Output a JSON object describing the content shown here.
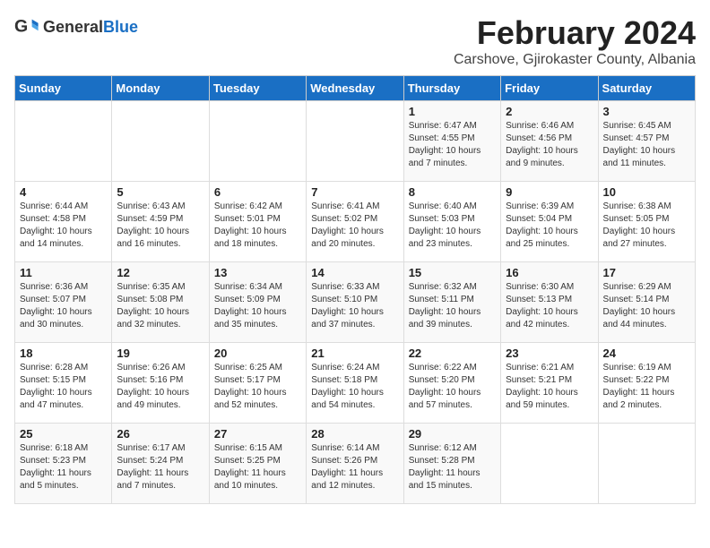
{
  "logo": {
    "general": "General",
    "blue": "Blue"
  },
  "title": "February 2024",
  "location": "Carshove, Gjirokaster County, Albania",
  "headers": [
    "Sunday",
    "Monday",
    "Tuesday",
    "Wednesday",
    "Thursday",
    "Friday",
    "Saturday"
  ],
  "weeks": [
    [
      {
        "day": "",
        "info": ""
      },
      {
        "day": "",
        "info": ""
      },
      {
        "day": "",
        "info": ""
      },
      {
        "day": "",
        "info": ""
      },
      {
        "day": "1",
        "info": "Sunrise: 6:47 AM\nSunset: 4:55 PM\nDaylight: 10 hours and 7 minutes."
      },
      {
        "day": "2",
        "info": "Sunrise: 6:46 AM\nSunset: 4:56 PM\nDaylight: 10 hours and 9 minutes."
      },
      {
        "day": "3",
        "info": "Sunrise: 6:45 AM\nSunset: 4:57 PM\nDaylight: 10 hours and 11 minutes."
      }
    ],
    [
      {
        "day": "4",
        "info": "Sunrise: 6:44 AM\nSunset: 4:58 PM\nDaylight: 10 hours and 14 minutes."
      },
      {
        "day": "5",
        "info": "Sunrise: 6:43 AM\nSunset: 4:59 PM\nDaylight: 10 hours and 16 minutes."
      },
      {
        "day": "6",
        "info": "Sunrise: 6:42 AM\nSunset: 5:01 PM\nDaylight: 10 hours and 18 minutes."
      },
      {
        "day": "7",
        "info": "Sunrise: 6:41 AM\nSunset: 5:02 PM\nDaylight: 10 hours and 20 minutes."
      },
      {
        "day": "8",
        "info": "Sunrise: 6:40 AM\nSunset: 5:03 PM\nDaylight: 10 hours and 23 minutes."
      },
      {
        "day": "9",
        "info": "Sunrise: 6:39 AM\nSunset: 5:04 PM\nDaylight: 10 hours and 25 minutes."
      },
      {
        "day": "10",
        "info": "Sunrise: 6:38 AM\nSunset: 5:05 PM\nDaylight: 10 hours and 27 minutes."
      }
    ],
    [
      {
        "day": "11",
        "info": "Sunrise: 6:36 AM\nSunset: 5:07 PM\nDaylight: 10 hours and 30 minutes."
      },
      {
        "day": "12",
        "info": "Sunrise: 6:35 AM\nSunset: 5:08 PM\nDaylight: 10 hours and 32 minutes."
      },
      {
        "day": "13",
        "info": "Sunrise: 6:34 AM\nSunset: 5:09 PM\nDaylight: 10 hours and 35 minutes."
      },
      {
        "day": "14",
        "info": "Sunrise: 6:33 AM\nSunset: 5:10 PM\nDaylight: 10 hours and 37 minutes."
      },
      {
        "day": "15",
        "info": "Sunrise: 6:32 AM\nSunset: 5:11 PM\nDaylight: 10 hours and 39 minutes."
      },
      {
        "day": "16",
        "info": "Sunrise: 6:30 AM\nSunset: 5:13 PM\nDaylight: 10 hours and 42 minutes."
      },
      {
        "day": "17",
        "info": "Sunrise: 6:29 AM\nSunset: 5:14 PM\nDaylight: 10 hours and 44 minutes."
      }
    ],
    [
      {
        "day": "18",
        "info": "Sunrise: 6:28 AM\nSunset: 5:15 PM\nDaylight: 10 hours and 47 minutes."
      },
      {
        "day": "19",
        "info": "Sunrise: 6:26 AM\nSunset: 5:16 PM\nDaylight: 10 hours and 49 minutes."
      },
      {
        "day": "20",
        "info": "Sunrise: 6:25 AM\nSunset: 5:17 PM\nDaylight: 10 hours and 52 minutes."
      },
      {
        "day": "21",
        "info": "Sunrise: 6:24 AM\nSunset: 5:18 PM\nDaylight: 10 hours and 54 minutes."
      },
      {
        "day": "22",
        "info": "Sunrise: 6:22 AM\nSunset: 5:20 PM\nDaylight: 10 hours and 57 minutes."
      },
      {
        "day": "23",
        "info": "Sunrise: 6:21 AM\nSunset: 5:21 PM\nDaylight: 10 hours and 59 minutes."
      },
      {
        "day": "24",
        "info": "Sunrise: 6:19 AM\nSunset: 5:22 PM\nDaylight: 11 hours and 2 minutes."
      }
    ],
    [
      {
        "day": "25",
        "info": "Sunrise: 6:18 AM\nSunset: 5:23 PM\nDaylight: 11 hours and 5 minutes."
      },
      {
        "day": "26",
        "info": "Sunrise: 6:17 AM\nSunset: 5:24 PM\nDaylight: 11 hours and 7 minutes."
      },
      {
        "day": "27",
        "info": "Sunrise: 6:15 AM\nSunset: 5:25 PM\nDaylight: 11 hours and 10 minutes."
      },
      {
        "day": "28",
        "info": "Sunrise: 6:14 AM\nSunset: 5:26 PM\nDaylight: 11 hours and 12 minutes."
      },
      {
        "day": "29",
        "info": "Sunrise: 6:12 AM\nSunset: 5:28 PM\nDaylight: 11 hours and 15 minutes."
      },
      {
        "day": "",
        "info": ""
      },
      {
        "day": "",
        "info": ""
      }
    ]
  ]
}
